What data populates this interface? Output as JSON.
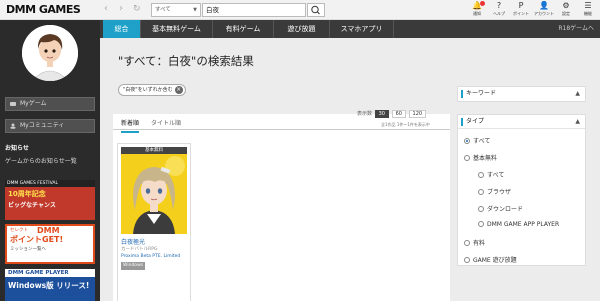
{
  "header": {
    "logo": "DMM GAMES",
    "back_arrow": "‹",
    "forward_arrow": "›",
    "reload_icon": "↻",
    "search_category": "すべて",
    "search_query": "白夜",
    "icons": [
      {
        "name": "notification-icon",
        "glyph": "🔔",
        "label": "通知"
      },
      {
        "name": "help-icon",
        "glyph": "?",
        "label": "ヘルプ"
      },
      {
        "name": "point-icon",
        "glyph": "P",
        "label": "ポイント"
      },
      {
        "name": "account-icon",
        "glyph": "👤",
        "label": "アカウント"
      },
      {
        "name": "settings-icon",
        "glyph": "⚙",
        "label": "設定"
      },
      {
        "name": "menu-icon",
        "glyph": "☰",
        "label": "機能"
      }
    ]
  },
  "sidebar": {
    "my_game": "Myゲーム",
    "my_community": "Myコミュニティ",
    "notice_heading": "お知らせ",
    "notice_link": "ゲームからのお知らせ一覧",
    "banners": [
      {
        "line1": "DMM GAMES FESTIVAL",
        "line2": "10周年記念",
        "line3": "ビッグなチャンス"
      },
      {
        "line1": "セレクト",
        "line2": "DMM",
        "line3": "ポイントGET!",
        "line4": "ミッション一覧へ"
      },
      {
        "line1": "DMM GAME PLAYER",
        "line2": "Windows版 リリース!"
      }
    ]
  },
  "tabs": [
    "総合",
    "基本無料ゲーム",
    "有料ゲーム",
    "遊び放題",
    "スマホアプリ"
  ],
  "r18_link": "R18ゲームへ",
  "main": {
    "title": "\"すべて：白夜\"の検索結果",
    "chip_text": "\"白夜\"をいずれか含む",
    "sort_tabs": [
      "新着順",
      "タイトル順"
    ],
    "perpage_label": "表示数",
    "perpage_options": [
      "30",
      "60",
      "120"
    ],
    "count_text": "全1作品 1件～1件を表示中",
    "card": {
      "badge": "基本無料",
      "title": "白夜極光",
      "genre": "カードバトルRPG",
      "maker": "Proxima Beta PTE. Limited",
      "platform": "Windows"
    }
  },
  "filters": {
    "keyword_heading": "キーワード",
    "type_heading": "タイプ",
    "options": [
      "すべて",
      "基本無料",
      "すべて",
      "ブラウザ",
      "ダウンロード",
      "DMM GAME APP PLAYER",
      "有料",
      "GAME 遊び放題"
    ]
  },
  "colors": {
    "accent": "#1ea0c8",
    "sidebar": "#2b2b2b",
    "link": "#1a66b0"
  }
}
